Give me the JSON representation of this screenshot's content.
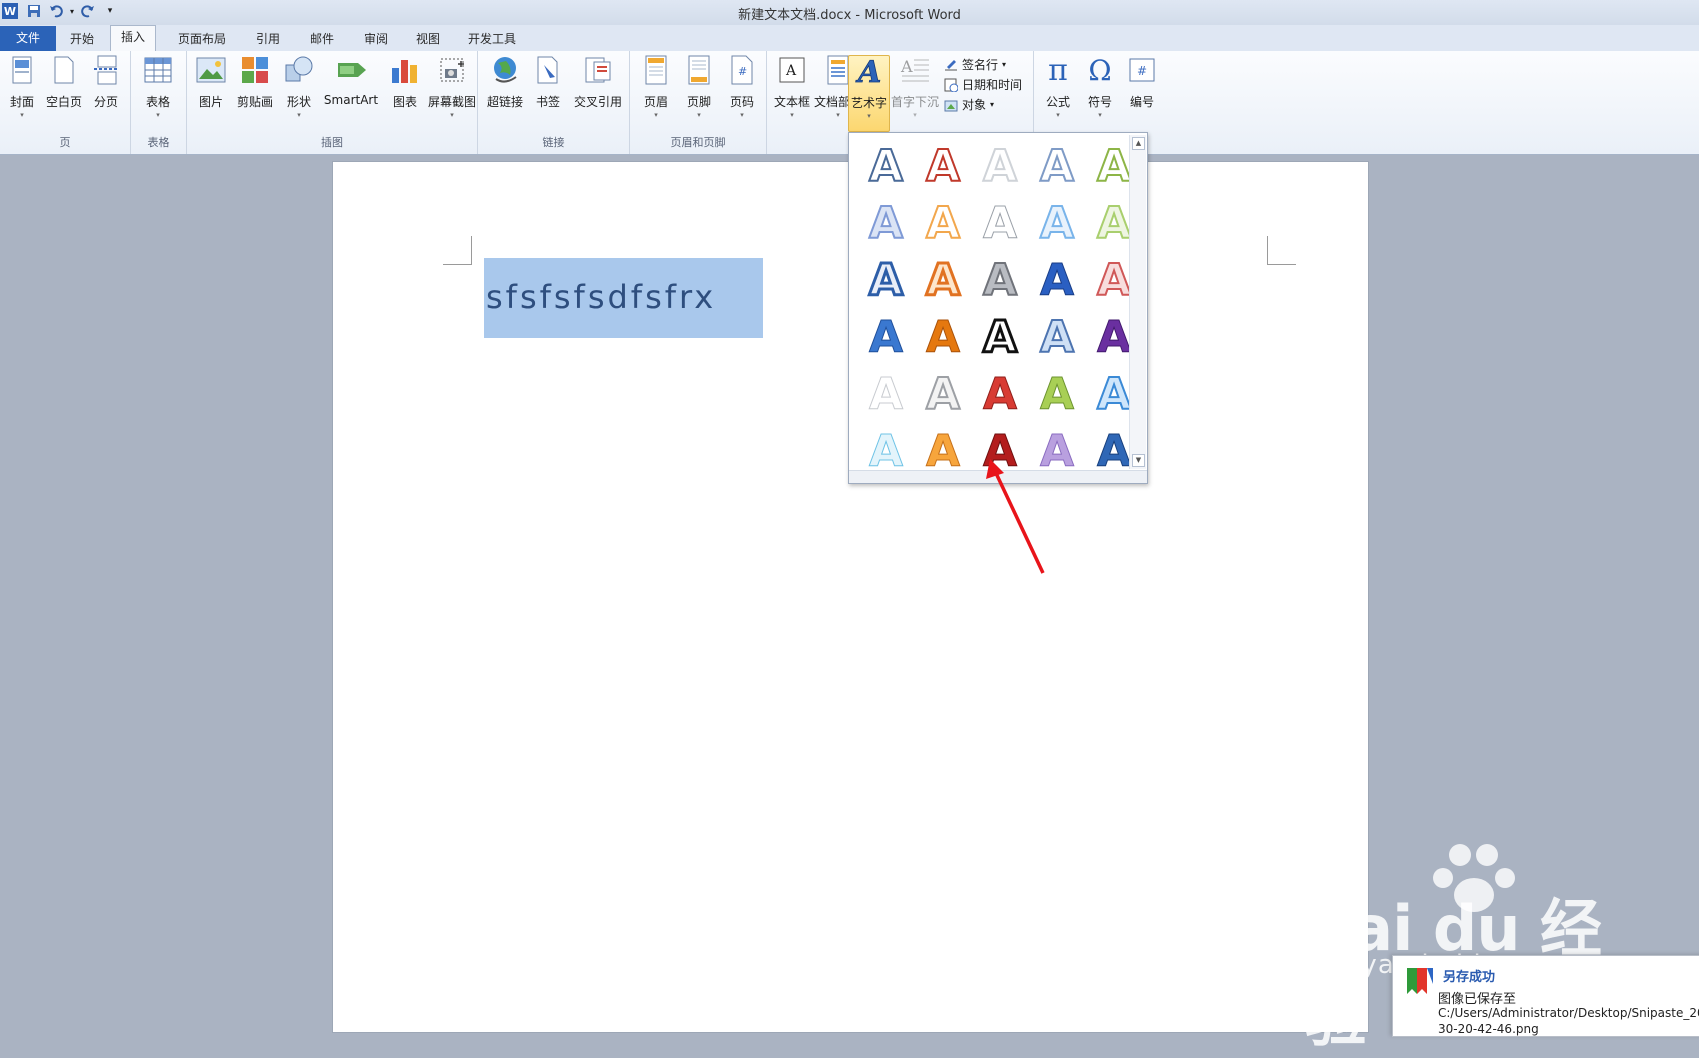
{
  "window": {
    "title": "新建文本文档.docx  -  Microsoft Word"
  },
  "tabs": [
    "文件",
    "开始",
    "插入",
    "页面布局",
    "引用",
    "邮件",
    "审阅",
    "视图",
    "开发工具"
  ],
  "ribbon": {
    "groups": {
      "page": {
        "label": "页",
        "buttons": [
          "封面",
          "空白页",
          "分页"
        ]
      },
      "table": {
        "label": "表格",
        "buttons": [
          "表格"
        ]
      },
      "illustrations": {
        "label": "插图",
        "buttons": [
          "图片",
          "剪贴画",
          "形状",
          "SmartArt",
          "图表",
          "屏幕截图"
        ]
      },
      "links": {
        "label": "链接",
        "buttons": [
          "超链接",
          "书签",
          "交叉引用"
        ]
      },
      "header_footer": {
        "label": "页眉和页脚",
        "buttons": [
          "页眉",
          "页脚",
          "页码"
        ]
      },
      "text": {
        "buttons": [
          "文本框",
          "文档部件",
          "艺术字",
          "首字下沉"
        ],
        "small": [
          "签名行",
          "日期和时间",
          "对象"
        ]
      },
      "symbols": {
        "buttons": [
          "公式",
          "符号",
          "编号"
        ]
      }
    }
  },
  "document": {
    "selected_text": "sfsfsfsdfsfrx"
  },
  "wordart_gallery": {
    "glyph": "A",
    "selected_style": "row 6, column 3"
  },
  "toast": {
    "title": "另存成功",
    "message": "图像已保存至",
    "path_line1": "C:/Users/Administrator/Desktop/Snipaste_20",
    "path_line2": "30-20-42-46.png"
  },
  "watermark": {
    "logo_text": "Bai du 经验",
    "url": "jingyan.baidu.com"
  }
}
